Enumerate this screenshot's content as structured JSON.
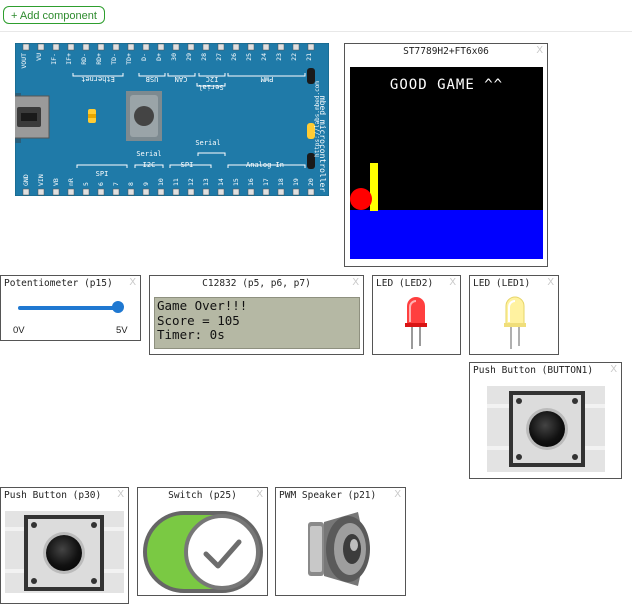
{
  "toolbar": {
    "add_component_label": "+ Add component"
  },
  "board": {
    "top_pins": [
      "VOUT",
      "VU",
      "IF-",
      "IF+",
      "RD-",
      "RD+",
      "TD-",
      "TD+",
      "D-",
      "D+",
      "30",
      "29",
      "28",
      "27",
      "26",
      "25",
      "24",
      "23",
      "22",
      "21"
    ],
    "bottom_pins": [
      "GND",
      "VIN",
      "VB",
      "nR",
      "5",
      "6",
      "7",
      "8",
      "9",
      "10",
      "11",
      "12",
      "13",
      "14",
      "15",
      "16",
      "17",
      "18",
      "19",
      "20"
    ],
    "top_groups": [
      "Ethernet",
      "USB",
      "CAN",
      "I2C",
      "PWM"
    ],
    "serial_top": "Serial",
    "bottom_groups": [
      "SPI",
      "Serial",
      "I2C",
      "SPI",
      "Serial",
      "Analog In"
    ],
    "side_text_1": "https://labs.mbed.com",
    "side_text_2": "mbed microcontroller",
    "colors": {
      "pcb": "#1f7aa8",
      "silk": "#ffffff"
    }
  },
  "lcd_panel": {
    "title": "ST7789H2+FT6x06",
    "close": "X",
    "screen_text": "GOOD GAME ^^",
    "colors": {
      "background": "#000000",
      "ground": "#0000ff",
      "paddle": "#ffff00",
      "ball": "#ff0000"
    }
  },
  "potentiometer": {
    "title": "Potentiometer (p15)",
    "close": "X",
    "min_label": "0V",
    "max_label": "5V",
    "value": 1.0,
    "color": "#1f78d1"
  },
  "c12832": {
    "title": "C12832 (p5, p6, p7)",
    "close": "X",
    "lines": [
      "Game Over!!!",
      "Score = 105",
      "Timer: 0s"
    ]
  },
  "led2": {
    "title": "LED (LED2)",
    "close": "X",
    "color": "#ff2a2a",
    "state": "on"
  },
  "led1": {
    "title": "LED (LED1)",
    "close": "X",
    "color": "#fff2a0",
    "state": "off"
  },
  "button1": {
    "title": "Push Button (BUTTON1)",
    "close": "X"
  },
  "button_p30": {
    "title": "Push Button (p30)",
    "close": "X"
  },
  "switch": {
    "title": "Switch (p25)",
    "close": "X",
    "state": "on",
    "color": "#7ac943",
    "icon": "check-icon"
  },
  "speaker": {
    "title": "PWM Speaker (p21)",
    "close": "X",
    "icon": "speaker-icon"
  }
}
